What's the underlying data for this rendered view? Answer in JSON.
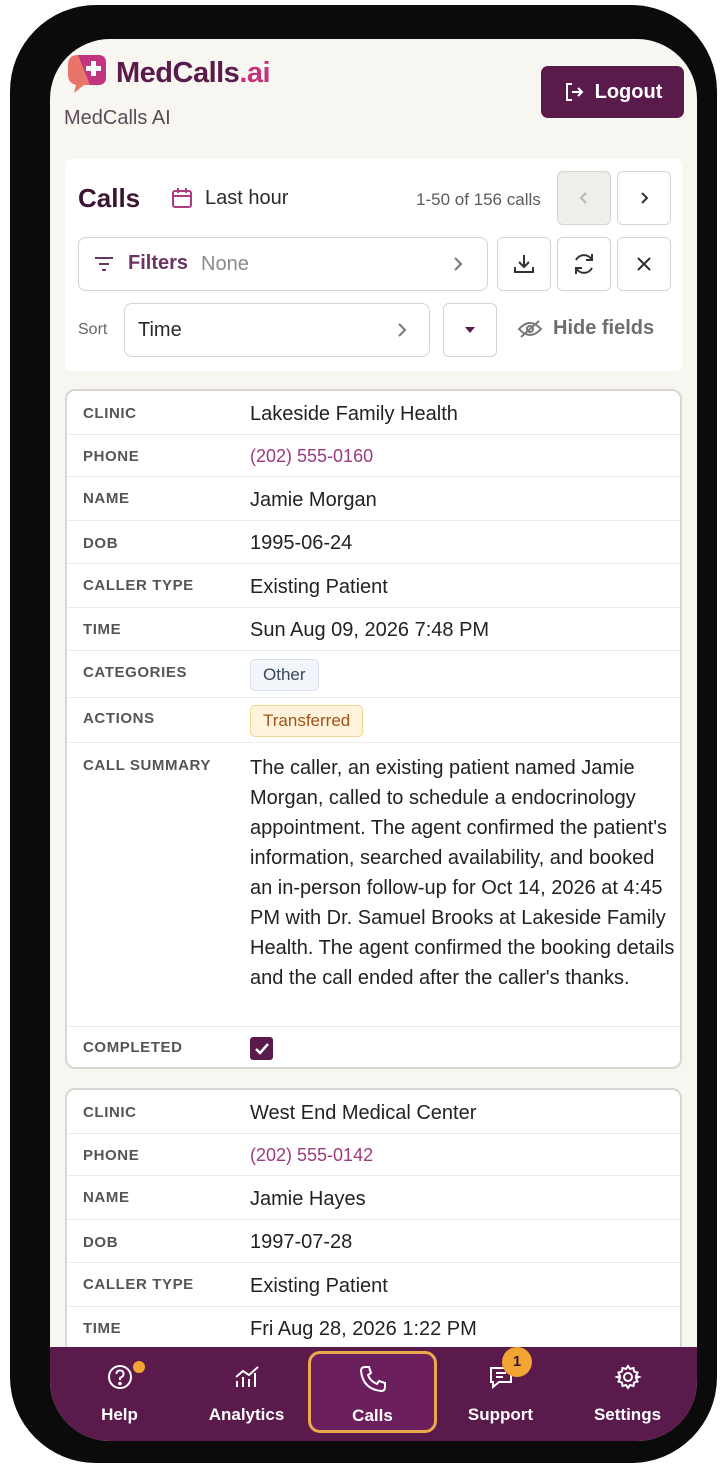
{
  "header": {
    "brand_main": "MedCalls",
    "brand_ai": ".ai",
    "subtitle": "MedCalls AI",
    "logout_label": "Logout"
  },
  "toolbar": {
    "title": "Calls",
    "range": "Last hour",
    "count": "1-50 of 156 calls",
    "filters_label": "Filters",
    "filters_value": "None",
    "sort_label": "Sort",
    "sort_value": "Time",
    "hide_fields_label": "Hide fields"
  },
  "labels": {
    "clinic": "CLINIC",
    "phone": "PHONE",
    "name": "NAME",
    "dob": "DOB",
    "caller_type": "CALLER TYPE",
    "time": "TIME",
    "categories": "CATEGORIES",
    "actions": "ACTIONS",
    "call_summary": "CALL SUMMARY",
    "completed": "COMPLETED"
  },
  "records": [
    {
      "clinic": "Lakeside Family Health",
      "phone": "(202) 555-0160",
      "name": "Jamie Morgan",
      "dob": "1995-06-24",
      "caller_type": "Existing Patient",
      "time": "Sun Aug 09, 2026 7:48 PM",
      "category": "Other",
      "action": "Transferred",
      "summary": "The caller, an existing patient named Jamie Morgan, called to schedule a endocrinology appointment. The agent confirmed the patient's information, searched availability, and booked an in-person follow-up for Oct 14, 2026 at 4:45 PM with Dr. Samuel Brooks at Lakeside Family Health. The agent confirmed the booking details and the call ended after the caller's thanks.",
      "completed": true
    },
    {
      "clinic": "West End Medical Center",
      "phone": "(202) 555-0142",
      "name": "Jamie Hayes",
      "dob": "1997-07-28",
      "caller_type": "Existing Patient",
      "time": "Fri Aug 28, 2026 1:22 PM"
    }
  ],
  "nav": {
    "items": [
      {
        "label": "Help",
        "icon": "help-icon"
      },
      {
        "label": "Analytics",
        "icon": "analytics-icon"
      },
      {
        "label": "Calls",
        "icon": "phone-icon"
      },
      {
        "label": "Support",
        "icon": "chat-icon",
        "badge": "1"
      },
      {
        "label": "Settings",
        "icon": "gear-icon"
      }
    ],
    "active": "Calls"
  },
  "colors": {
    "brand": "#5a1a4c",
    "accent": "#c2357e",
    "highlight": "#f2a533"
  }
}
